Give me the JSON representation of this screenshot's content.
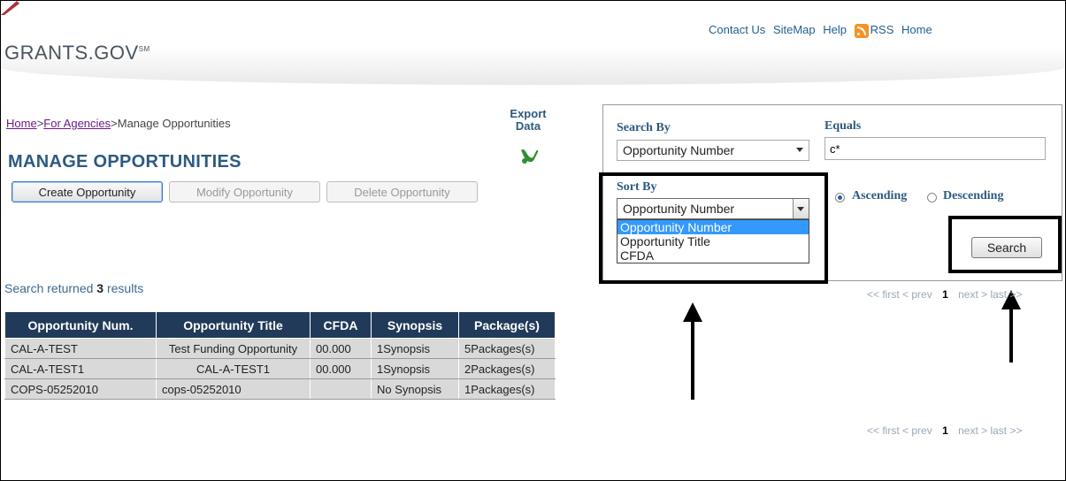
{
  "header": {
    "logo_text": "GRANTS.GOV",
    "logo_sup": "SM",
    "links": [
      "Contact Us",
      "SiteMap",
      "Help",
      "RSS",
      "Home"
    ]
  },
  "breadcrumb": {
    "home": "Home",
    "sep": ">",
    "agencies": "For Agencies",
    "current": "Manage Opportunities"
  },
  "page_title": "MANAGE OPPORTUNITIES",
  "actions": {
    "create": "Create Opportunity",
    "modify": "Modify Opportunity",
    "delete": "Delete Opportunity"
  },
  "export": {
    "label": "Export Data",
    "icon": "export-excel-icon"
  },
  "results": {
    "prefix": "Search returned",
    "count": "3",
    "suffix": "results"
  },
  "table": {
    "headers": [
      "Opportunity Num.",
      "Opportunity Title",
      "CFDA",
      "Synopsis",
      "Package(s)"
    ],
    "rows": [
      [
        "CAL-A-TEST",
        "Test Funding Opportunity",
        "00.000",
        "1Synopsis",
        "5Packages(s)"
      ],
      [
        "CAL-A-TEST1",
        "CAL-A-TEST1",
        "00.000",
        "1Synopsis",
        "2Packages(s)"
      ],
      [
        "COPS-05252010",
        "cops-05252010",
        "",
        "No Synopsis",
        "1Packages(s)"
      ]
    ]
  },
  "search": {
    "search_by_label": "Search By",
    "search_by_value": "Opportunity Number",
    "equals_label": "Equals",
    "equals_value": "c*",
    "sort_by_label": "Sort By",
    "sort_by_value": "Opportunity Number",
    "sort_options": [
      "Opportunity Number",
      "Opportunity Title",
      "CFDA"
    ],
    "ascending_label": "Ascending",
    "descending_label": "Descending",
    "order_selected": "Ascending",
    "search_button": "Search"
  },
  "pager": {
    "first": "<< first",
    "prev": "< prev",
    "page": "1",
    "next": "next >",
    "last": "last >>"
  },
  "colors": {
    "header_bg": "#213a59",
    "title": "#2c5a80",
    "row_bg": "#d9d9d9",
    "highlight": "#3399ff"
  }
}
